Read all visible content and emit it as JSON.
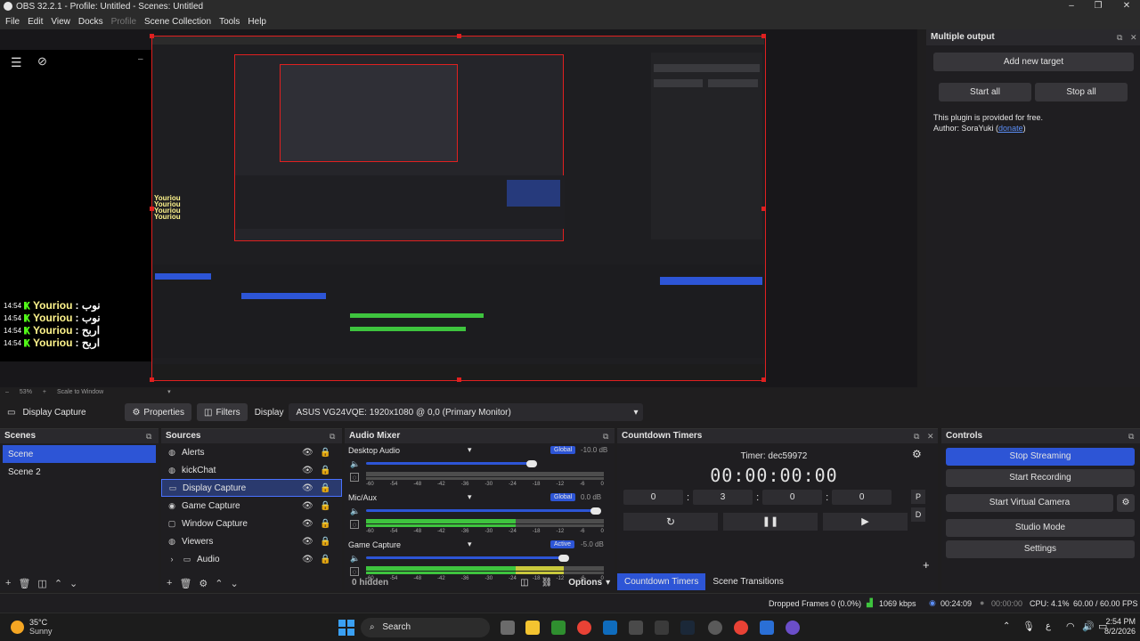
{
  "window": {
    "title": "OBS 32.2.1 - Profile: Untitled - Scenes: Untitled",
    "minimize": "–",
    "maximize": "❐",
    "close": "✕"
  },
  "menu": [
    "File",
    "Edit",
    "View",
    "Docks",
    "Profile",
    "Scene Collection",
    "Tools",
    "Help"
  ],
  "preview": {
    "chat": [
      {
        "time": "14:54",
        "name": "Youriou",
        "msg": ": نوب"
      },
      {
        "time": "14:54",
        "name": "Youriou",
        "msg": ": نوب"
      },
      {
        "time": "14:54",
        "name": "Youriou",
        "msg": ": اربح"
      },
      {
        "time": "14:54",
        "name": "Youriou",
        "msg": ": اربح"
      }
    ],
    "zoom": "53%",
    "scale_mode": "Scale to Window"
  },
  "multiple_output": {
    "title": "Multiple output",
    "add_target": "Add new target",
    "start_all": "Start all",
    "stop_all": "Stop all",
    "info_line1": "This plugin is provided for free.",
    "info_author": "Author: SoraYuki (",
    "info_link": "donate",
    "info_close": ")"
  },
  "source_toolbar": {
    "source_name": "Display Capture",
    "properties": "Properties",
    "filters": "Filters",
    "display_label": "Display",
    "display_value": "ASUS VG24VQE: 1920x1080 @ 0,0 (Primary Monitor)"
  },
  "scenes": {
    "title": "Scenes",
    "items": [
      "Scene",
      "Scene 2"
    ]
  },
  "sources": {
    "title": "Sources",
    "items": [
      "Alerts",
      "kickChat",
      "Display Capture",
      "Game Capture",
      "Window Capture",
      "Viewers",
      "Audio"
    ]
  },
  "mixer": {
    "title": "Audio Mixer",
    "tracks": [
      {
        "name": "Desktop Audio",
        "badge": "Global",
        "db": "-10.0 dB",
        "level": 0.72,
        "meter": 0
      },
      {
        "name": "Mic/Aux",
        "badge": "Global",
        "db": "0.0 dB",
        "level": 1.0,
        "meter": 0.63
      },
      {
        "name": "Game Capture",
        "badge": "Active",
        "db": "-5.0 dB",
        "level": 0.86,
        "meter": 0.83
      }
    ],
    "scale": [
      "-60",
      "-54",
      "-48",
      "-42",
      "-36",
      "-30",
      "-24",
      "-18",
      "-12",
      "-6",
      "0"
    ],
    "hidden": "0 hidden",
    "options": "Options"
  },
  "countdown": {
    "title": "Countdown Timers",
    "timer_label": "Timer: dec59972",
    "display": "00:00:00:00",
    "inputs": [
      "0",
      "3",
      "0",
      "0"
    ],
    "p_btn": "P",
    "d_btn": "D",
    "tabs": [
      "Countdown Timers",
      "Scene Transitions"
    ]
  },
  "controls": {
    "title": "Controls",
    "buttons": [
      "Stop Streaming",
      "Start Recording",
      "Start Virtual Camera",
      "Studio Mode",
      "Settings"
    ]
  },
  "status": {
    "dropped": "Dropped Frames 0 (0.0%)",
    "bitrate": "1069 kbps",
    "stream_time": "00:24:09",
    "rec_time": "00:00:00",
    "cpu": "CPU: 4.1%",
    "fps": "60.00 / 60.00 FPS"
  },
  "taskbar": {
    "weather_temp": "35°C",
    "weather_desc": "Sunny",
    "search": "Search",
    "lang": "ع",
    "time": "2:54 PM",
    "date": "8/2/2026"
  },
  "colors": {
    "accent": "#2d55d6",
    "selection_red": "#e02020",
    "meter_green": "#3ec43e",
    "meter_yellow": "#c8c83c"
  }
}
